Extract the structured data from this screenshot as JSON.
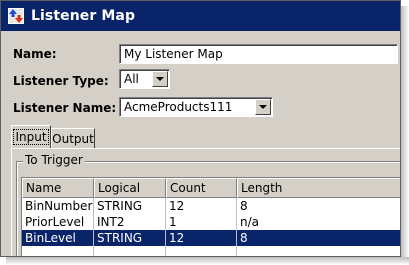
{
  "window": {
    "title": "Listener Map"
  },
  "form": {
    "name_label": "Name:",
    "name_value": "My Listener Map",
    "type_label": "Listener Type:",
    "type_value": "All",
    "listener_name_label": "Listener Name:",
    "listener_name_value": "AcmeProducts111"
  },
  "tabs": [
    {
      "label": "Input",
      "active": true
    },
    {
      "label": "Output",
      "active": false
    }
  ],
  "group": {
    "title": "To Trigger"
  },
  "table": {
    "columns": [
      "Name",
      "Logical",
      "Count",
      "Length"
    ],
    "rows": [
      {
        "cells": [
          "BinNumber",
          "STRING",
          "12",
          "8"
        ],
        "selected": false
      },
      {
        "cells": [
          "PriorLevel",
          "INT2",
          "1",
          "n/a"
        ],
        "selected": false
      },
      {
        "cells": [
          "BinLevel",
          "STRING",
          "12",
          "8"
        ],
        "selected": true
      }
    ]
  },
  "colors": {
    "titlebar": "#0a246a",
    "selection": "#0a246a",
    "face": "#d4d0c8"
  },
  "icons": {
    "app": "up-down-arrows-icon",
    "dropdown": "chevron-down-icon"
  }
}
